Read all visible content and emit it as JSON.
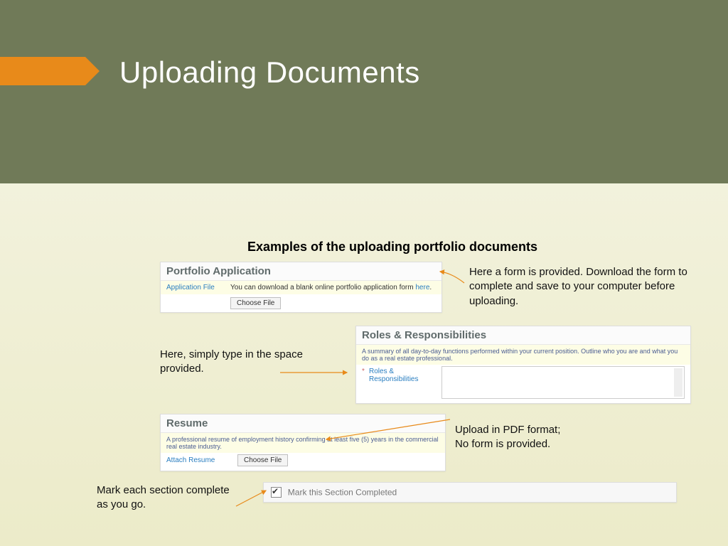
{
  "title": "Uploading Documents",
  "subhead": "Examples of the uploading portfolio documents",
  "pane1": {
    "header": "Portfolio Application",
    "label": "Application File",
    "text_a": "You can download a blank online portfolio application form ",
    "link": "here",
    "text_b": ".",
    "button": "Choose File"
  },
  "note1": "Here a form is provided. Download the form to complete and save to your computer before uploading.",
  "pane2": {
    "header": "Roles & Responsibilities",
    "desc": "A summary of all day-to-day functions performed within your current position. Outline who you are and what you do as a real estate professional.",
    "label": "Roles & Responsibilities"
  },
  "note2": "Here, simply type in the space provided.",
  "pane3": {
    "header": "Resume",
    "desc": "A professional resume of employment history confirming at least five (5) years in the commercial real estate industry.",
    "label": "Attach Resume",
    "button": "Choose File"
  },
  "note3": "Upload in PDF format;\nNo form is provided.",
  "pane4": {
    "label": "Mark this Section Completed"
  },
  "note4": "Mark each section complete as you go."
}
